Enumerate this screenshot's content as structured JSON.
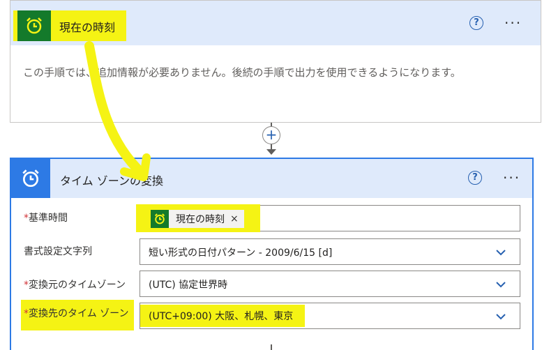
{
  "card1": {
    "title": "現在の時刻",
    "description": "この手順では、追加情報が必要ありません。後続の手順で出力を使用できるようになります。",
    "help_label": "?",
    "more_label": "···"
  },
  "add_step_label": "+",
  "card2": {
    "title": "タイム ゾーンの変換",
    "help_label": "?",
    "more_label": "···",
    "fields": [
      {
        "label": "基準時間",
        "required": "*",
        "token": "現在の時刻",
        "token_remove": "×"
      },
      {
        "label": "書式設定文字列",
        "value": "短い形式の日付パターン - 2009/6/15 [d]"
      },
      {
        "label": "変換元のタイムゾーン",
        "required": "*",
        "value": "(UTC) 協定世界時"
      },
      {
        "label": "変換先のタイム ゾーン",
        "required": "*",
        "value": "(UTC+09:00) 大阪、札幌、東京"
      }
    ]
  },
  "colors": {
    "trigger_green": "#147a2b",
    "action_blue": "#2d7ae5",
    "header_bg": "#dfeafb",
    "highlight": "#f5f314",
    "required_red": "#d13438"
  },
  "icons": [
    "alarm-clock-icon",
    "help-icon",
    "more-icon",
    "chevron-down-icon",
    "plus-icon",
    "close-icon"
  ]
}
